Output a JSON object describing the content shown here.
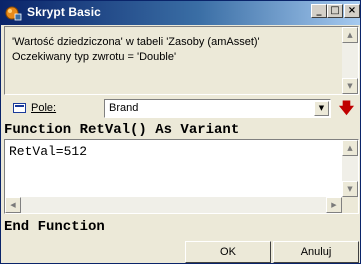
{
  "window": {
    "title": "Skrypt Basic",
    "controls": {
      "minimize": "_",
      "maximize": "□",
      "close": "×"
    }
  },
  "description": {
    "line1": "'Wartość dziedziczona' w tabeli 'Zasoby (amAsset)'",
    "line2": "Oczekiwany typ zwrotu = 'Double'"
  },
  "field": {
    "label": "Pole:",
    "value": "Brand",
    "icon": "field-list-icon",
    "go_icon": "red-down-arrow-icon"
  },
  "code": {
    "header": "Function RetVal() As Variant",
    "body": "RetVal=512",
    "footer": "End Function"
  },
  "buttons": {
    "ok": "OK",
    "cancel": "Anuluj"
  },
  "colors": {
    "title_gradient_start": "#0a246a",
    "title_gradient_end": "#a6caf0",
    "dialog_bg": "#ece9d8",
    "go_arrow": "#c00000"
  }
}
